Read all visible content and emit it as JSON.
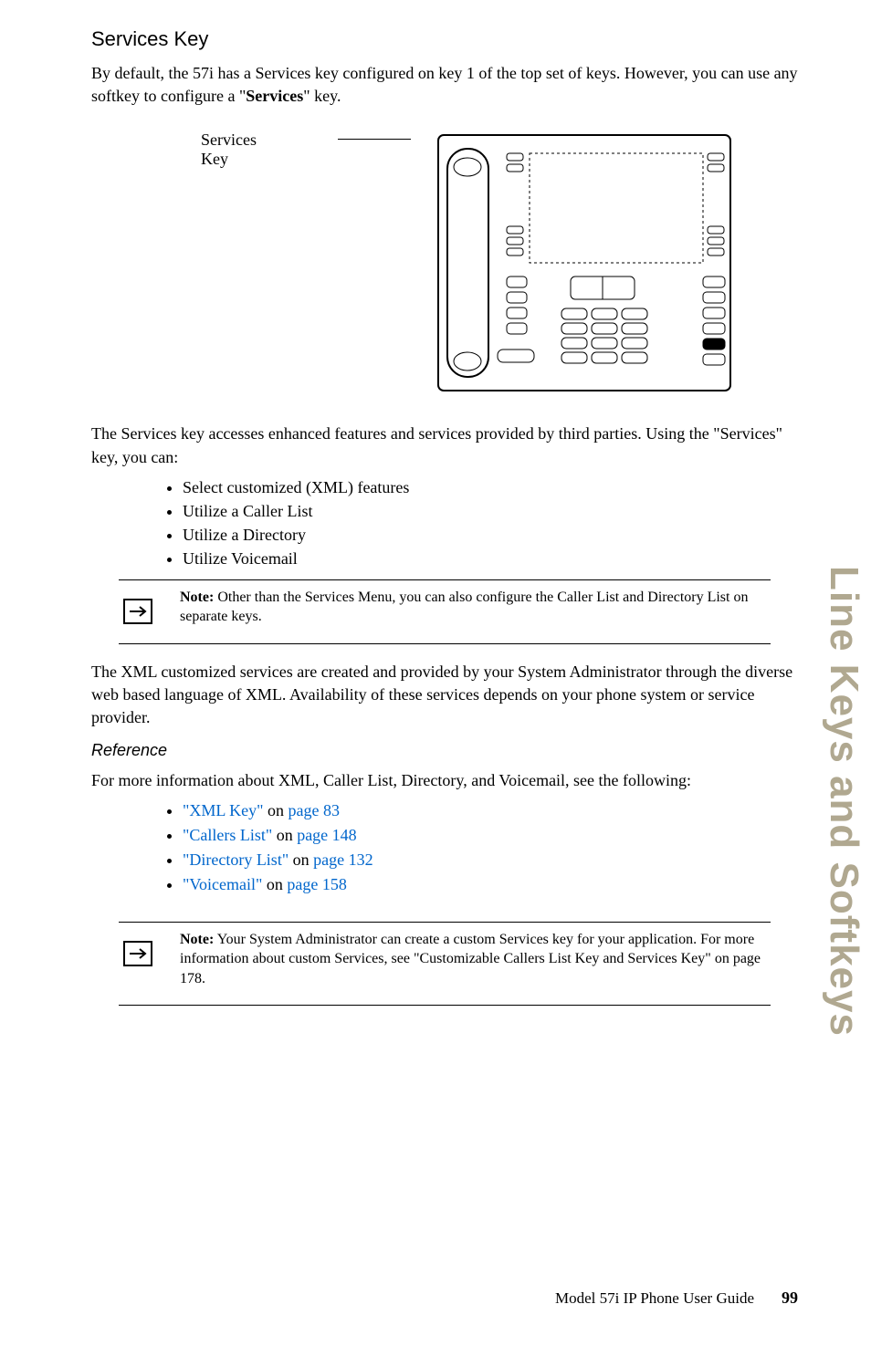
{
  "heading": "Services Key",
  "intro_prefix": "By default, the 57i has a Services key configured on key 1 of the top set of keys. However, you can use any softkey to configure a \"",
  "intro_bold": "Services",
  "intro_suffix": "\" key.",
  "figure_label_l1": "Services",
  "figure_label_l2": "Key",
  "para_services_access": "The Services key accesses enhanced features and services provided by third parties. Using the \"Services\" key, you can:",
  "bullets": {
    "b0": "Select customized (XML) features",
    "b1": "Utilize a Caller List",
    "b2": "Utilize a Directory",
    "b3": "Utilize Voicemail"
  },
  "note1_label": "Note:",
  "note1_text": " Other than the Services Menu, you can also configure the Caller List and Directory List on separate keys.",
  "xml_para": "The XML customized services are created and provided by your System Administrator through the diverse web based language of XML. Availability of these services depends on your phone system or service provider.",
  "reference_heading": "Reference",
  "reference_intro": "For more information about XML, Caller List, Directory, and Voicemail, see the following:",
  "links": {
    "l0_a": "\"XML Key\"",
    "l0_mid": " on ",
    "l0_b": "page 83",
    "l1_a": "\"Callers List\"",
    "l1_mid": " on ",
    "l1_b": "page 148",
    "l2_a": "\"Directory List\"",
    "l2_mid": " on ",
    "l2_b": "page 132",
    "l3_a": "\"Voicemail\"",
    "l3_mid": " on ",
    "l3_b": "page 158"
  },
  "note2_label": "Note:",
  "note2_text": " Your System Administrator can create a custom Services key for your application. For more information about custom Services, see \"Customizable Callers List Key and Services Key\" on page 178.",
  "side_tab": "Line Keys and Softkeys",
  "footer_guide": "Model 57i IP Phone User Guide",
  "footer_page": "99"
}
